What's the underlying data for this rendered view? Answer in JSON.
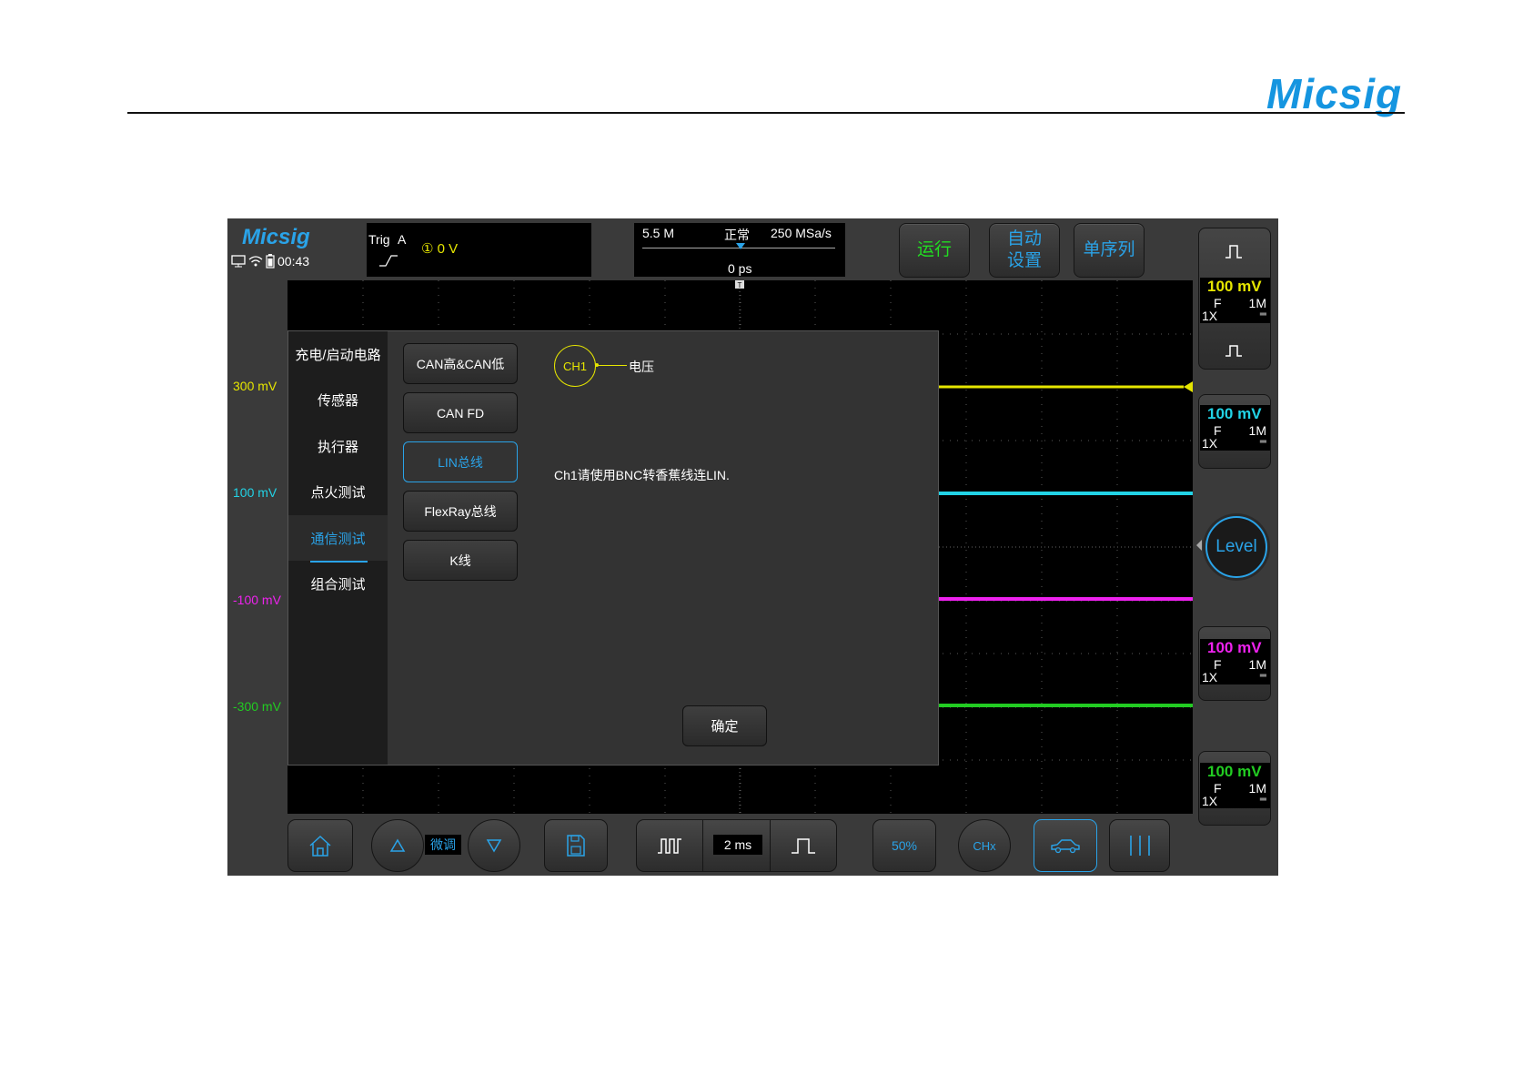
{
  "page": {
    "brand": "Micsig"
  },
  "scope": {
    "logo": "Micsig",
    "status": {
      "time": "00:43"
    },
    "trigger": {
      "label": "Trig",
      "source": "A",
      "level": "① 0 V"
    },
    "timebase": {
      "depth": "5.5 M",
      "mode": "正常",
      "rate": "250 MSa/s",
      "offset": "0 ps",
      "scale": "2 ms"
    },
    "buttons": {
      "run": "运行",
      "auto_setup_line1": "自动",
      "auto_setup_line2": "设置",
      "single": "单序列"
    },
    "voltage_labels": [
      {
        "text": "300 mV",
        "color": "#e6e600"
      },
      {
        "text": "100 mV",
        "color": "#22d3e6"
      },
      {
        "text": "-100 mV",
        "color": "#ee22ee"
      },
      {
        "text": "-300 mV",
        "color": "#22cc22"
      }
    ],
    "channels": [
      {
        "scale": "100 mV",
        "coupling": "F",
        "impedance": "1M",
        "probe": "1X",
        "color": "#e6e600"
      },
      {
        "scale": "100 mV",
        "coupling": "F",
        "impedance": "1M",
        "probe": "1X",
        "color": "#22d3e6"
      },
      {
        "scale": "100 mV",
        "coupling": "F",
        "impedance": "1M",
        "probe": "1X",
        "color": "#ee22ee"
      },
      {
        "scale": "100 mV",
        "coupling": "F",
        "impedance": "1M",
        "probe": "1X",
        "color": "#22cc22"
      }
    ],
    "level_button": "Level",
    "toolbar": {
      "fine_label": "微调",
      "percent": "50%",
      "hz": "CHx"
    }
  },
  "dialog": {
    "categories": [
      "充电/启动电路",
      "传感器",
      "执行器",
      "点火测试",
      "通信测试",
      "组合测试"
    ],
    "active_category": "通信测试",
    "options": [
      "CAN高&CAN低",
      "CAN FD",
      "LIN总线",
      "FlexRay总线",
      "K线"
    ],
    "active_option": "LIN总线",
    "channel": "CH1",
    "channel_label": "电压",
    "instruction": "Ch1请使用BNC转香蕉线连LIN.",
    "confirm": "确定"
  },
  "colors": {
    "accent": "#2aa3e8",
    "ch1": "#e6e600",
    "ch2": "#22d3e6",
    "ch3": "#ee22ee",
    "ch4": "#22cc22"
  }
}
